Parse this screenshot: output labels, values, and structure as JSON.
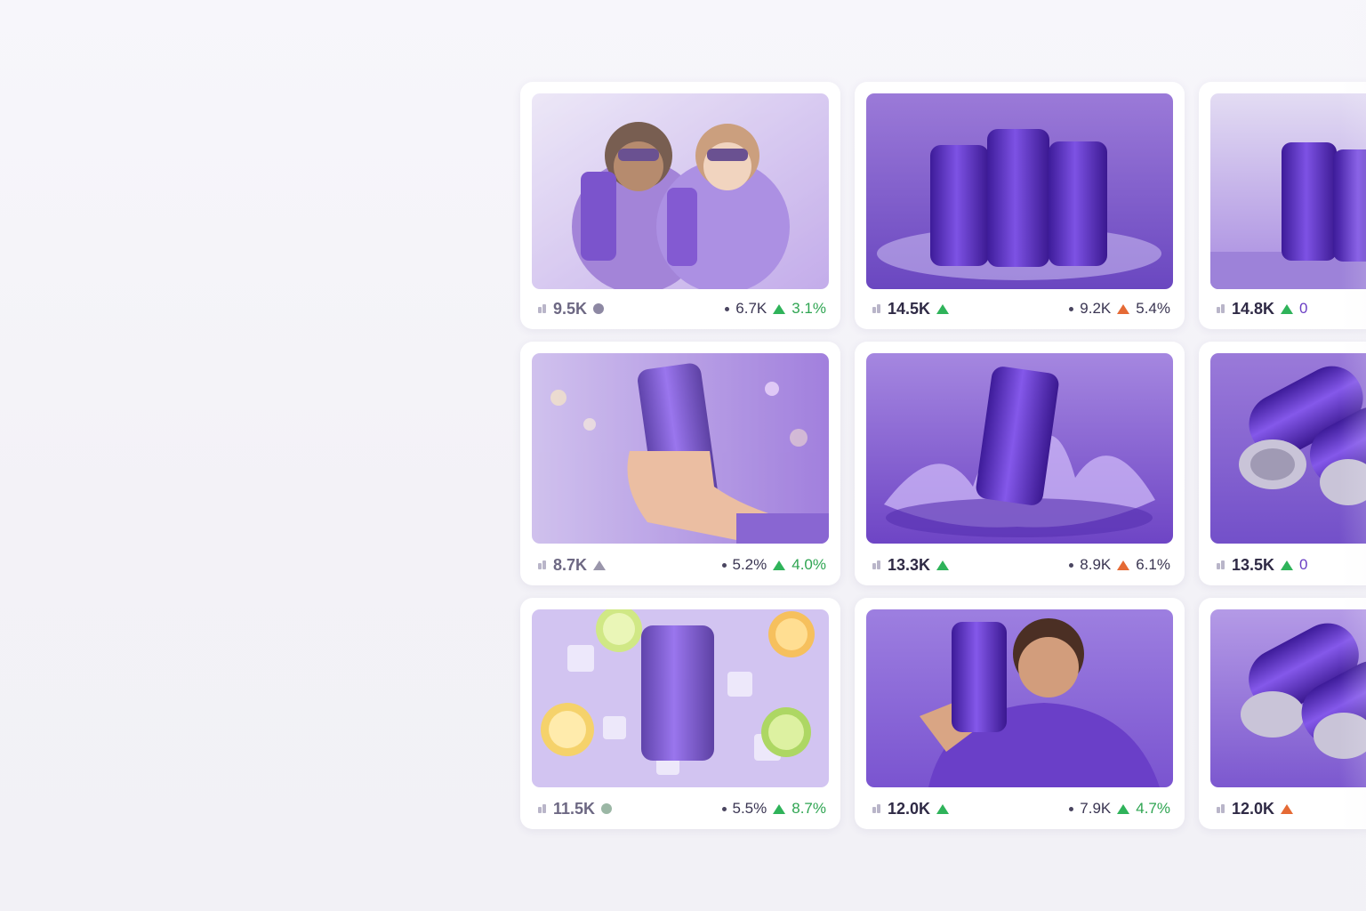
{
  "cards": [
    {
      "name": "friends-toast",
      "views": "9.5K",
      "status": "dot",
      "status_color": "#8d88a3",
      "secondary": "6.7K",
      "trend": "up",
      "trend_color": "#2fb35a",
      "rate": "3.1%",
      "faded": true
    },
    {
      "name": "three-cans-mist",
      "views": "14.5K",
      "status": "up",
      "status_color": "#2fb35a",
      "secondary": "9.2K",
      "trend": "up",
      "trend_color": "#e56a35",
      "rate": "5.4%",
      "faded": false
    },
    {
      "name": "cans-reflection",
      "views": "14.8K",
      "status": "up",
      "status_color": "#2fb35a",
      "secondary": "",
      "trend": "",
      "rate": "0",
      "faded": false
    },
    {
      "name": "hand-can-city",
      "views": "8.7K",
      "status": "up",
      "status_color": "#9a96ab",
      "secondary": "5.2%",
      "trend": "up",
      "trend_color": "#2fb35a",
      "rate": "4.0%",
      "faded": true
    },
    {
      "name": "can-splash",
      "views": "13.3K",
      "status": "up",
      "status_color": "#2fb35a",
      "secondary": "8.9K",
      "trend": "up",
      "trend_color": "#e56a35",
      "rate": "6.1%",
      "faded": false
    },
    {
      "name": "cans-lying",
      "views": "13.5K",
      "status": "up",
      "status_color": "#2fb35a",
      "secondary": "",
      "trend": "",
      "rate": "0",
      "faded": false
    },
    {
      "name": "can-ice-citrus",
      "views": "11.5K",
      "status": "dot",
      "status_color": "#9bb7a5",
      "secondary": "5.5%",
      "trend": "up",
      "trend_color": "#2fb35a",
      "rate": "8.7%",
      "faded": true
    },
    {
      "name": "man-hoodie-can",
      "views": "12.0K",
      "status": "up",
      "status_color": "#2fb35a",
      "secondary": "7.9K",
      "trend": "up",
      "trend_color": "#2fb35a",
      "rate": "4.7%",
      "faded": false
    },
    {
      "name": "cans-stacked",
      "views": "12.0K",
      "status": "up",
      "status_color": "#e56a35",
      "secondary": "",
      "trend": "",
      "rate": "",
      "faded": false
    }
  ],
  "colors": {
    "accent": "#7b4fd6",
    "positive": "#2fb35a",
    "negative": "#e56a35"
  }
}
